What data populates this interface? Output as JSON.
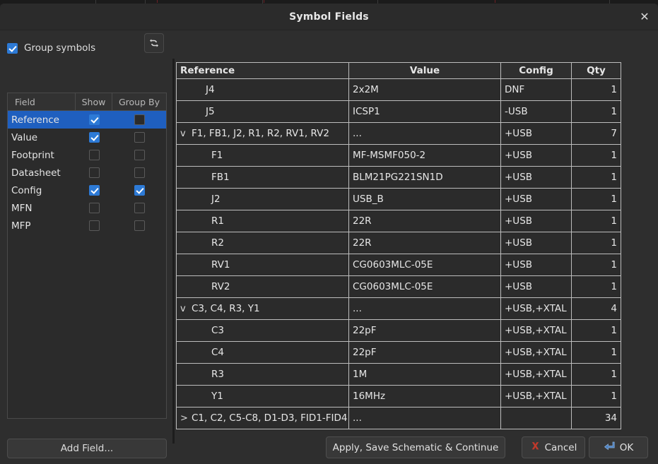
{
  "window": {
    "title": "Symbol Fields",
    "close_label": "✕",
    "close_icon": "close-icon"
  },
  "left_panel": {
    "group_symbols": {
      "label": "Group symbols",
      "checked": true
    },
    "refresh_icon": "refresh-icon",
    "fields_table": {
      "headers": [
        "Field",
        "Show",
        "Group By"
      ],
      "rows": [
        {
          "name": "Reference",
          "show": true,
          "group_by": false,
          "selected": true
        },
        {
          "name": "Value",
          "show": true,
          "group_by": false,
          "selected": false
        },
        {
          "name": "Footprint",
          "show": false,
          "group_by": false,
          "selected": false
        },
        {
          "name": "Datasheet",
          "show": false,
          "group_by": false,
          "selected": false
        },
        {
          "name": "Config",
          "show": true,
          "group_by": true,
          "selected": false
        },
        {
          "name": "MFN",
          "show": false,
          "group_by": false,
          "selected": false
        },
        {
          "name": "MFP",
          "show": false,
          "group_by": false,
          "selected": false
        }
      ]
    },
    "add_field_label": "Add Field..."
  },
  "grid": {
    "headers": [
      "Reference",
      "Value",
      "Config",
      "Qty"
    ],
    "rows": [
      {
        "twisty": "",
        "level": "top",
        "reference": "J4",
        "value": "2x2M",
        "config": "DNF",
        "qty": "1"
      },
      {
        "twisty": "",
        "level": "top",
        "reference": "J5",
        "value": "ICSP1",
        "config": "-USB",
        "qty": "1"
      },
      {
        "twisty": "v",
        "level": "group",
        "reference": "F1, FB1, J2, R1, R2, RV1, RV2",
        "value": "...",
        "config": "+USB",
        "qty": "7"
      },
      {
        "twisty": "",
        "level": "child",
        "reference": "F1",
        "value": "MF-MSMF050-2",
        "config": "+USB",
        "qty": "1"
      },
      {
        "twisty": "",
        "level": "child",
        "reference": "FB1",
        "value": "BLM21PG221SN1D",
        "config": "+USB",
        "qty": "1"
      },
      {
        "twisty": "",
        "level": "child",
        "reference": "J2",
        "value": "USB_B",
        "config": "+USB",
        "qty": "1"
      },
      {
        "twisty": "",
        "level": "child",
        "reference": "R1",
        "value": "22R",
        "config": "+USB",
        "qty": "1"
      },
      {
        "twisty": "",
        "level": "child",
        "reference": "R2",
        "value": "22R",
        "config": "+USB",
        "qty": "1"
      },
      {
        "twisty": "",
        "level": "child",
        "reference": "RV1",
        "value": "CG0603MLC-05E",
        "config": "+USB",
        "qty": "1"
      },
      {
        "twisty": "",
        "level": "child",
        "reference": "RV2",
        "value": "CG0603MLC-05E",
        "config": "+USB",
        "qty": "1"
      },
      {
        "twisty": "v",
        "level": "group",
        "reference": "C3, C4, R3, Y1",
        "value": "...",
        "config": "+USB,+XTAL",
        "qty": "4"
      },
      {
        "twisty": "",
        "level": "child",
        "reference": "C3",
        "value": "22pF",
        "config": "+USB,+XTAL",
        "qty": "1"
      },
      {
        "twisty": "",
        "level": "child",
        "reference": "C4",
        "value": "22pF",
        "config": "+USB,+XTAL",
        "qty": "1"
      },
      {
        "twisty": "",
        "level": "child",
        "reference": "R3",
        "value": "1M",
        "config": "+USB,+XTAL",
        "qty": "1"
      },
      {
        "twisty": "",
        "level": "child",
        "reference": "Y1",
        "value": "16MHz",
        "config": "+USB,+XTAL",
        "qty": "1"
      },
      {
        "twisty": ">",
        "level": "group",
        "reference": "C1, C2, C5-C8, D1-D3, FID1-FID4",
        "value": "...",
        "config": "",
        "qty": "34"
      }
    ]
  },
  "footer": {
    "apply_label": "Apply, Save Schematic & Continue",
    "cancel_label": "Cancel",
    "cancel_icon": "red-x-icon",
    "ok_label": "OK",
    "ok_icon": "enter-arrow-icon"
  },
  "colors": {
    "dialog_bg": "#2e2e2e",
    "titlebar_bg": "#2b2b2b",
    "selection_blue": "#1f5fbf",
    "checkbox_blue": "#2d7ad6",
    "grid_line": "#bdbdbd",
    "cancel_red": "#c0392b",
    "ok_blue": "#4a7fc1"
  }
}
